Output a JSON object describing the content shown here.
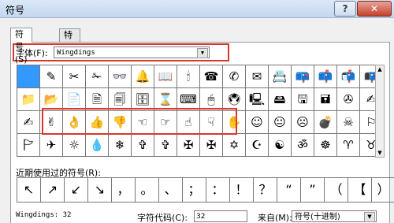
{
  "window": {
    "title": "符号",
    "help": "?",
    "close": "✕"
  },
  "tabs": [
    {
      "label": "符号(S)"
    },
    {
      "label": "特殊字符(P)"
    }
  ],
  "font": {
    "label": "字体(F):",
    "value": "Wingdings"
  },
  "grid": {
    "rows": [
      [
        "",
        "✎",
        "✂",
        "✁",
        "👓",
        "🔔",
        "📖",
        "🕯",
        "☎",
        "✆",
        "✉",
        "📇",
        "📪",
        "📫",
        "📬",
        "📭"
      ],
      [
        "📁",
        "📂",
        "📄",
        "🗎",
        "🗐",
        "🗄",
        "⌛",
        "⌨",
        "🖱",
        "🖲",
        "🖳",
        "🖴",
        "🖫",
        "🖬",
        "✇",
        "✍"
      ],
      [
        "✍",
        "✌",
        "👌",
        "👍",
        "👎",
        "☜",
        "☞",
        "☝",
        "☟",
        "✋",
        "☺",
        "😐",
        "☹",
        "💣",
        "☠",
        "⚐"
      ],
      [
        "🏱",
        "✈",
        "☼",
        "💧",
        "❄",
        "✞",
        "✞",
        "✠",
        "✠",
        "✡",
        "☪",
        "☯",
        "ॐ",
        "☸",
        "♈",
        "♉"
      ]
    ]
  },
  "scrollbar": {
    "up": "▲",
    "down": "▼"
  },
  "recent": {
    "label": "近期使用过的符号(R):",
    "items": [
      "↖",
      "↗",
      "↙",
      "↘",
      "，",
      "。",
      "、",
      "；",
      "：",
      "！",
      "？",
      "“",
      "”",
      "（",
      "【",
      "）"
    ]
  },
  "status": {
    "text": "Wingdings: 32"
  },
  "char_code": {
    "label": "字符代码(C):",
    "value": "32"
  },
  "from": {
    "label": "来自(M):",
    "value": "符号(十进制)"
  }
}
